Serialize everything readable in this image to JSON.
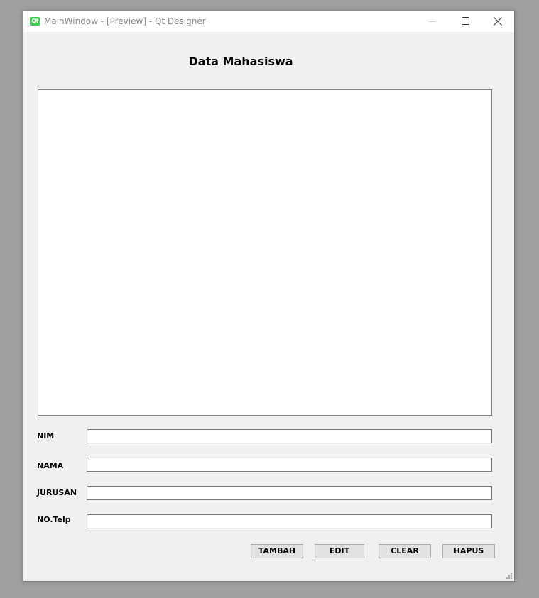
{
  "window": {
    "title": "MainWindow - [Preview] - Qt Designer",
    "app_icon_text": "Qt"
  },
  "form": {
    "heading": "Data Mahasiswa",
    "fields": [
      {
        "label": "NIM",
        "value": ""
      },
      {
        "label": "NAMA",
        "value": ""
      },
      {
        "label": "JURUSAN",
        "value": ""
      },
      {
        "label": "NO.Telp",
        "value": ""
      }
    ],
    "buttons": {
      "tambah": "TAMBAH",
      "edit": "EDIT",
      "clear": "CLEAR",
      "hapus": "HAPUS"
    }
  },
  "colors": {
    "window_bg": "#f0f0f0",
    "titlebar_bg": "#ffffff",
    "qt_green": "#41cd52",
    "button_bg": "#e1e1e1"
  },
  "icons": [
    "qt-logo-icon",
    "minimize-icon",
    "maximize-icon",
    "close-icon",
    "size-grip-icon"
  ]
}
